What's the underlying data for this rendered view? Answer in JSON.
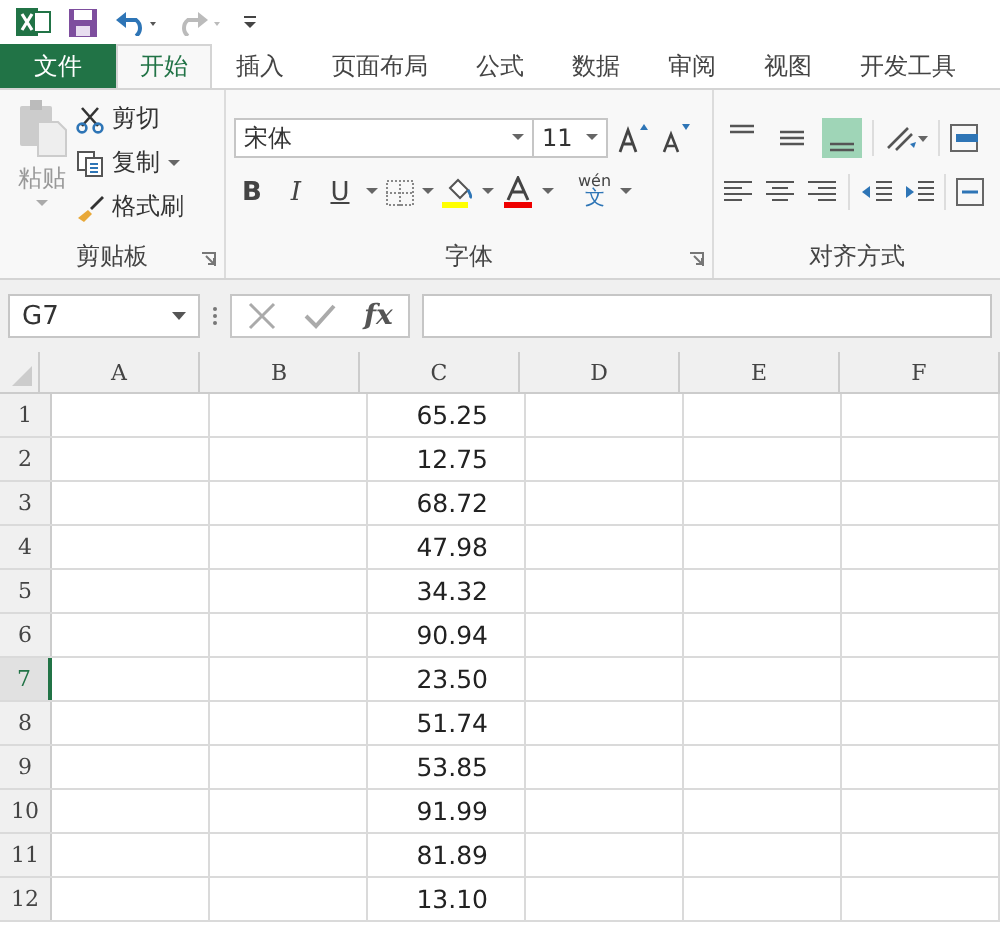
{
  "tabs": [
    {
      "label": "文件",
      "kind": "file",
      "selected": false
    },
    {
      "label": "开始",
      "kind": "tab",
      "selected": true
    },
    {
      "label": "插入",
      "kind": "tab",
      "selected": false
    },
    {
      "label": "页面布局",
      "kind": "tab",
      "selected": false
    },
    {
      "label": "公式",
      "kind": "tab",
      "selected": false
    },
    {
      "label": "数据",
      "kind": "tab",
      "selected": false
    },
    {
      "label": "审阅",
      "kind": "tab",
      "selected": false
    },
    {
      "label": "视图",
      "kind": "tab",
      "selected": false
    },
    {
      "label": "开发工具",
      "kind": "tab",
      "selected": false
    }
  ],
  "clipboard": {
    "paste": "粘贴",
    "cut": "剪切",
    "copy": "复制",
    "format_painter": "格式刷",
    "label": "剪贴板"
  },
  "font": {
    "font_name": "宋体",
    "font_size": "11",
    "bold": "B",
    "italic": "I",
    "underline": "U",
    "phonetic_top": "wén",
    "phonetic_bottom": "文",
    "label": "字体"
  },
  "alignment": {
    "label": "对齐方式",
    "vertical": [
      {
        "selected": false
      },
      {
        "selected": false
      },
      {
        "selected": true
      }
    ]
  },
  "name_box": "G7",
  "fx": "fx",
  "columns": [
    "A",
    "B",
    "C",
    "D",
    "E",
    "F"
  ],
  "rows": [
    {
      "number": "1",
      "c": "65.25",
      "selected": false
    },
    {
      "number": "2",
      "c": "12.75",
      "selected": false
    },
    {
      "number": "3",
      "c": "68.72",
      "selected": false
    },
    {
      "number": "4",
      "c": "47.98",
      "selected": false
    },
    {
      "number": "5",
      "c": "34.32",
      "selected": false
    },
    {
      "number": "6",
      "c": "90.94",
      "selected": false
    },
    {
      "number": "7",
      "c": "23.50",
      "selected": true
    },
    {
      "number": "8",
      "c": "51.74",
      "selected": false
    },
    {
      "number": "9",
      "c": "53.85",
      "selected": false
    },
    {
      "number": "10",
      "c": "91.99",
      "selected": false
    },
    {
      "number": "11",
      "c": "81.89",
      "selected": false
    },
    {
      "number": "12",
      "c": "13.10",
      "selected": false
    }
  ]
}
